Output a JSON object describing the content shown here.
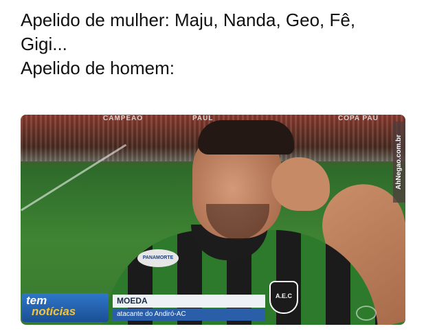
{
  "caption": {
    "line1": "Apelido de mulher: Maju, Nanda, Geo, Fê,",
    "line2": "Gigi...",
    "line3": "Apelido de homem:"
  },
  "photo": {
    "stadium_ads": [
      "CAMPEAO",
      "PAUL",
      "COPA PAU"
    ],
    "watermark": "AhNegao.com.br",
    "sponsor_badge": "PANAMORTE",
    "club_crest": "A.E.C"
  },
  "lower_third": {
    "logo_line1": "tem",
    "logo_line2": "notícias",
    "name": "MOEDA",
    "role": "atacante do Andiró-AC"
  }
}
